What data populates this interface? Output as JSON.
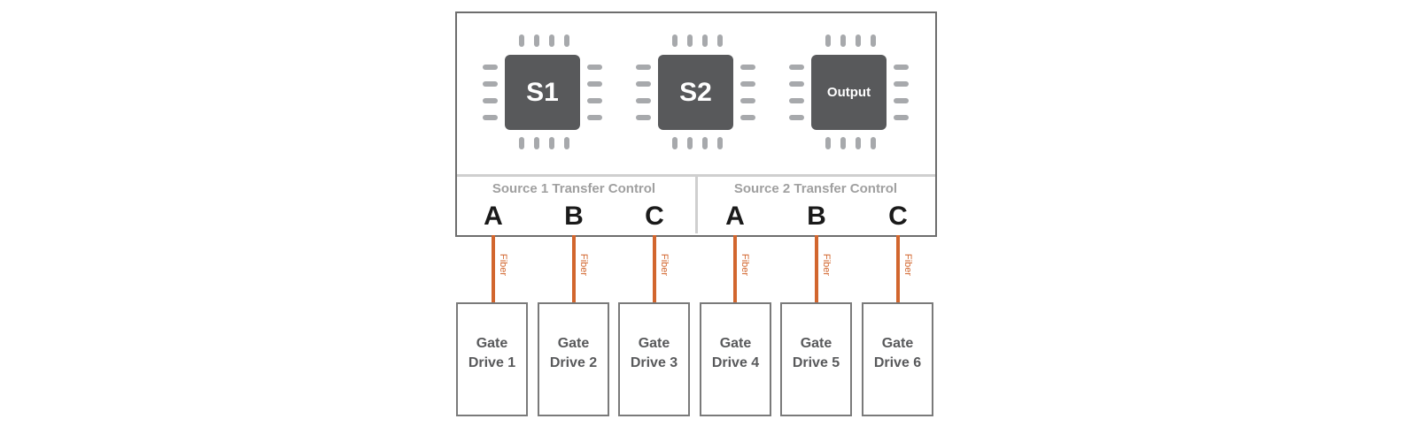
{
  "chips": [
    {
      "label": "S1"
    },
    {
      "label": "S2"
    },
    {
      "label": "Output"
    }
  ],
  "sections": [
    {
      "title": "Source 1 Transfer Control",
      "channels": [
        "A",
        "B",
        "C"
      ]
    },
    {
      "title": "Source 2 Transfer Control",
      "channels": [
        "A",
        "B",
        "C"
      ]
    }
  ],
  "link_label": "Fiber",
  "gate_drives": [
    {
      "line1": "Gate",
      "line2": "Drive 1"
    },
    {
      "line1": "Gate",
      "line2": "Drive 2"
    },
    {
      "line1": "Gate",
      "line2": "Drive 3"
    },
    {
      "line1": "Gate",
      "line2": "Drive 4"
    },
    {
      "line1": "Gate",
      "line2": "Drive 5"
    },
    {
      "line1": "Gate",
      "line2": "Drive 6"
    }
  ],
  "colors": {
    "fiber": "#d2662e",
    "chip": "#58595b",
    "pin": "#a7a9ac"
  }
}
